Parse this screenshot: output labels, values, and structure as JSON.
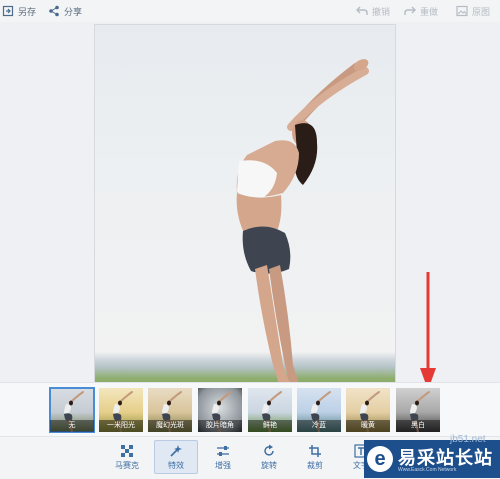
{
  "toolbar": {
    "save_as": "另存",
    "share": "分享",
    "undo": "撤销",
    "redo": "重做",
    "original": "原图"
  },
  "filters": [
    {
      "label": "无",
      "selected": true
    },
    {
      "label": "一米阳光",
      "selected": false
    },
    {
      "label": "魔幻光斑",
      "selected": false
    },
    {
      "label": "胶片暗角",
      "selected": false
    },
    {
      "label": "鲜艳",
      "selected": false
    },
    {
      "label": "冷蓝",
      "selected": false
    },
    {
      "label": "暖黄",
      "selected": false
    },
    {
      "label": "黑白",
      "selected": false
    }
  ],
  "tools": {
    "mosaic": "马赛克",
    "effects": "特效",
    "enhance": "增强",
    "rotate": "旋转",
    "crop": "裁剪",
    "text": "文字"
  },
  "watermark": {
    "logo_letter": "e",
    "name": "易采站长站",
    "subtitle": "Www.Easck.Com Network",
    "site": "jb51.net"
  },
  "colors": {
    "accent": "#4a8bd6",
    "arrow": "#e53935",
    "watermark_bg": "#1c4f8c"
  }
}
